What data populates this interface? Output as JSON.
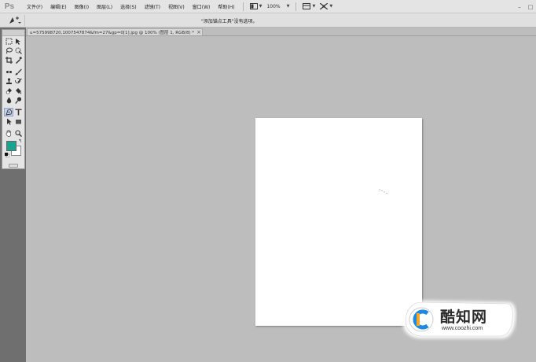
{
  "app": {
    "logo_text": "Ps"
  },
  "menubar": {
    "items": [
      "文件(F)",
      "编辑(E)",
      "图像(I)",
      "图层(L)",
      "选择(S)",
      "滤镜(T)",
      "视图(V)",
      "窗口(W)",
      "帮助(H)"
    ],
    "zoom_level": "100%"
  },
  "options_bar": {
    "message": "\"添加锚点工具\"没有选项。"
  },
  "document_tab": {
    "title": "u=575998720,1007547874&fm=27&gp=0[1].jpg @ 100% (图层 1, RGB/8) *",
    "close": "×"
  },
  "colors": {
    "foreground": "#1aa38e",
    "background": "#ffffff",
    "canvas_bg": "#bdbdbd",
    "watermark_accent": "#1e88e5"
  },
  "watermark": {
    "text": "酷知网",
    "url": "www.coozhi.com"
  }
}
